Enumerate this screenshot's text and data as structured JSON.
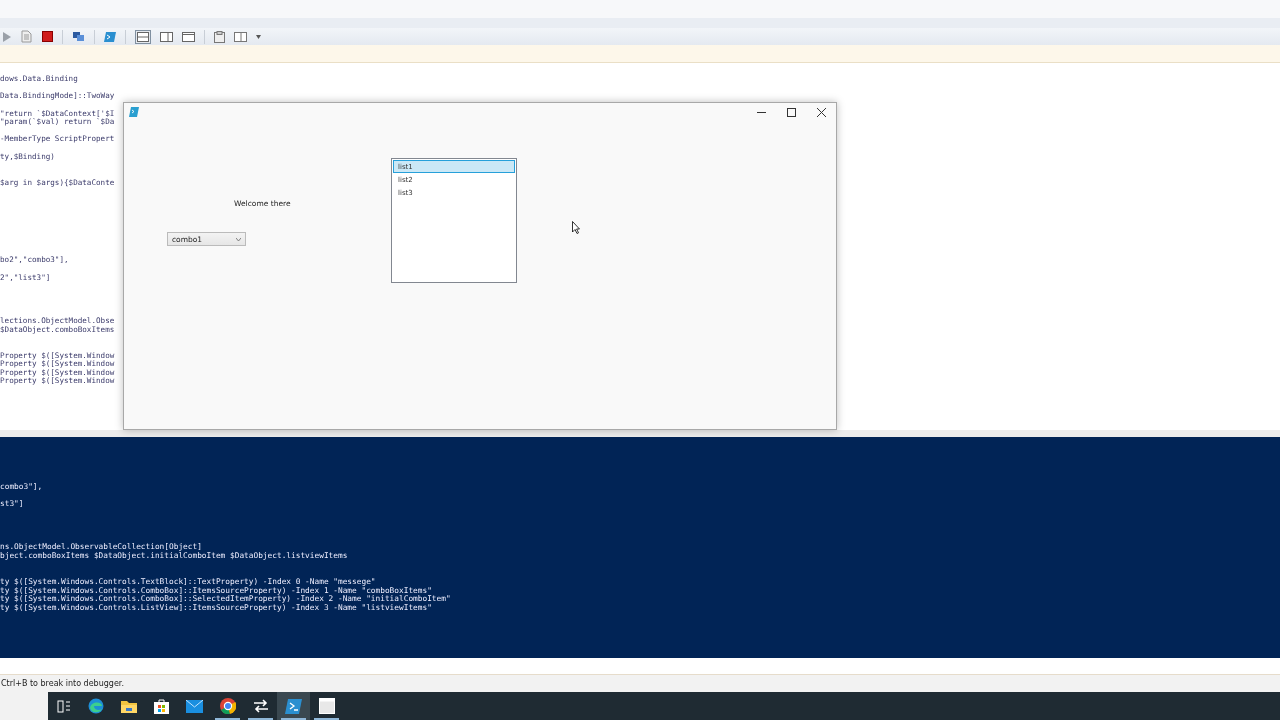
{
  "editor": {
    "lines": [
      {
        "kind": "code",
        "text": "dows.Data.Binding"
      },
      {
        "kind": "blank"
      },
      {
        "kind": "code",
        "text": "Data.BindingMode]::TwoWay"
      },
      {
        "kind": "blank"
      },
      {
        "kind": "code",
        "text": "\"return `$DataContext['$I"
      },
      {
        "kind": "code",
        "text": "\"param(`$val) return `$Da"
      },
      {
        "kind": "blank"
      },
      {
        "kind": "code",
        "text": "-MemberType ScriptPropert"
      },
      {
        "kind": "blank"
      },
      {
        "kind": "code",
        "text": "ty,$Binding)"
      },
      {
        "kind": "blank"
      },
      {
        "kind": "blank"
      },
      {
        "kind": "code",
        "text": "$arg in $args){$DataConte"
      },
      {
        "kind": "blank"
      },
      {
        "kind": "blank"
      },
      {
        "kind": "blank"
      },
      {
        "kind": "blank"
      },
      {
        "kind": "blank"
      },
      {
        "kind": "blank"
      },
      {
        "kind": "blank"
      },
      {
        "kind": "blank"
      },
      {
        "kind": "code",
        "text": "bo2\",\"combo3\"],"
      },
      {
        "kind": "blank"
      },
      {
        "kind": "code",
        "text": "2\",\"list3\"]"
      },
      {
        "kind": "blank"
      },
      {
        "kind": "blank"
      },
      {
        "kind": "blank"
      },
      {
        "kind": "blank"
      },
      {
        "kind": "code",
        "text": "lections.ObjectModel.Obse"
      },
      {
        "kind": "code",
        "text": "$DataObject.comboBoxItems"
      },
      {
        "kind": "blank"
      },
      {
        "kind": "blank"
      },
      {
        "kind": "code",
        "text": "Property $([System.Window"
      },
      {
        "kind": "code",
        "text": "Property $([System.Window"
      },
      {
        "kind": "code",
        "text": "Property $([System.Window"
      },
      {
        "kind": "code",
        "text": "Property $([System.Window"
      }
    ]
  },
  "console": {
    "lines": [
      {
        "kind": "code",
        "text": "combo3\"],"
      },
      {
        "kind": "blank"
      },
      {
        "kind": "code",
        "text": "st3\"]"
      },
      {
        "kind": "blank"
      },
      {
        "kind": "blank"
      },
      {
        "kind": "blank"
      },
      {
        "kind": "blank"
      },
      {
        "kind": "code",
        "text": "ns.ObjectModel.ObservableCollection[Object]"
      },
      {
        "kind": "code",
        "text": "bject.comboBoxItems $DataObject.initialComboItem $DataObject.listviewItems"
      },
      {
        "kind": "blank"
      },
      {
        "kind": "blank"
      },
      {
        "kind": "code",
        "text": "ty $([System.Windows.Controls.TextBlock]::TextProperty) -Index 0 -Name \"messege\""
      },
      {
        "kind": "code",
        "text": "ty $([System.Windows.Controls.ComboBox]::ItemsSourceProperty) -Index 1 -Name \"comboBoxItems\""
      },
      {
        "kind": "code",
        "text": "ty $([System.Windows.Controls.ComboBox]::SelectedItemProperty) -Index 2 -Name \"initialComboItem\""
      },
      {
        "kind": "code",
        "text": "ty $([System.Windows.Controls.ListView]::ItemsSourceProperty) -Index 3 -Name \"listviewItems\""
      }
    ]
  },
  "dialog": {
    "message": "Welcome there",
    "combo": {
      "value": "combo1"
    },
    "list": [
      {
        "label": "list1",
        "selected": true
      },
      {
        "label": "list2",
        "selected": false
      },
      {
        "label": "list3",
        "selected": false
      }
    ]
  },
  "status_bar": {
    "text": "Ctrl+B to break into debugger."
  },
  "taskbar": {
    "items": [
      {
        "running": false,
        "active": false
      },
      {
        "running": false,
        "active": false
      },
      {
        "running": false,
        "active": false
      },
      {
        "running": false,
        "active": false
      },
      {
        "running": false,
        "active": false
      },
      {
        "running": true,
        "active": false
      },
      {
        "running": true,
        "active": false
      },
      {
        "running": true,
        "active": true
      },
      {
        "running": true,
        "active": false
      }
    ]
  }
}
